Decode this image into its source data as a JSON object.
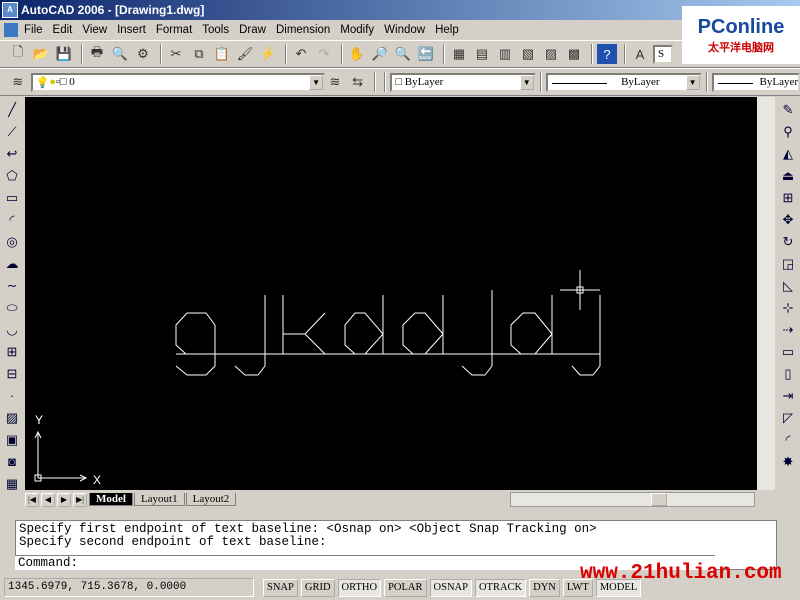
{
  "title": "AutoCAD 2006 - [Drawing1.dwg]",
  "menu": [
    "File",
    "Edit",
    "View",
    "Insert",
    "Format",
    "Tools",
    "Draw",
    "Dimension",
    "Modify",
    "Window",
    "Help"
  ],
  "layer_combo": "0",
  "color_combo": "ByLayer",
  "linetype_combo": "ByLayer",
  "lineweight_combo": "ByLayer",
  "style_combo": "S",
  "logo": {
    "brand": "PConline",
    "sub": "太平洋电脑网"
  },
  "drawing_text": "gjkddjdj",
  "ucs": {
    "x": "X",
    "y": "Y"
  },
  "tabs": [
    "Model",
    "Layout1",
    "Layout2"
  ],
  "command": {
    "lines": [
      "Specify first endpoint of text baseline:  <Osnap on>  <Object Snap Tracking on>",
      "Specify second endpoint of text baseline:"
    ],
    "prompt": "Command:"
  },
  "status": {
    "coords": "1345.6979, 715.3678, 0.0000",
    "buttons": [
      {
        "label": "SNAP",
        "on": false
      },
      {
        "label": "GRID",
        "on": false
      },
      {
        "label": "ORTHO",
        "on": true
      },
      {
        "label": "POLAR",
        "on": false
      },
      {
        "label": "OSNAP",
        "on": true
      },
      {
        "label": "OTRACK",
        "on": true
      },
      {
        "label": "DYN",
        "on": false
      },
      {
        "label": "LWT",
        "on": false
      },
      {
        "label": "MODEL",
        "on": true
      }
    ]
  },
  "watermark": "www.21hulian.com"
}
